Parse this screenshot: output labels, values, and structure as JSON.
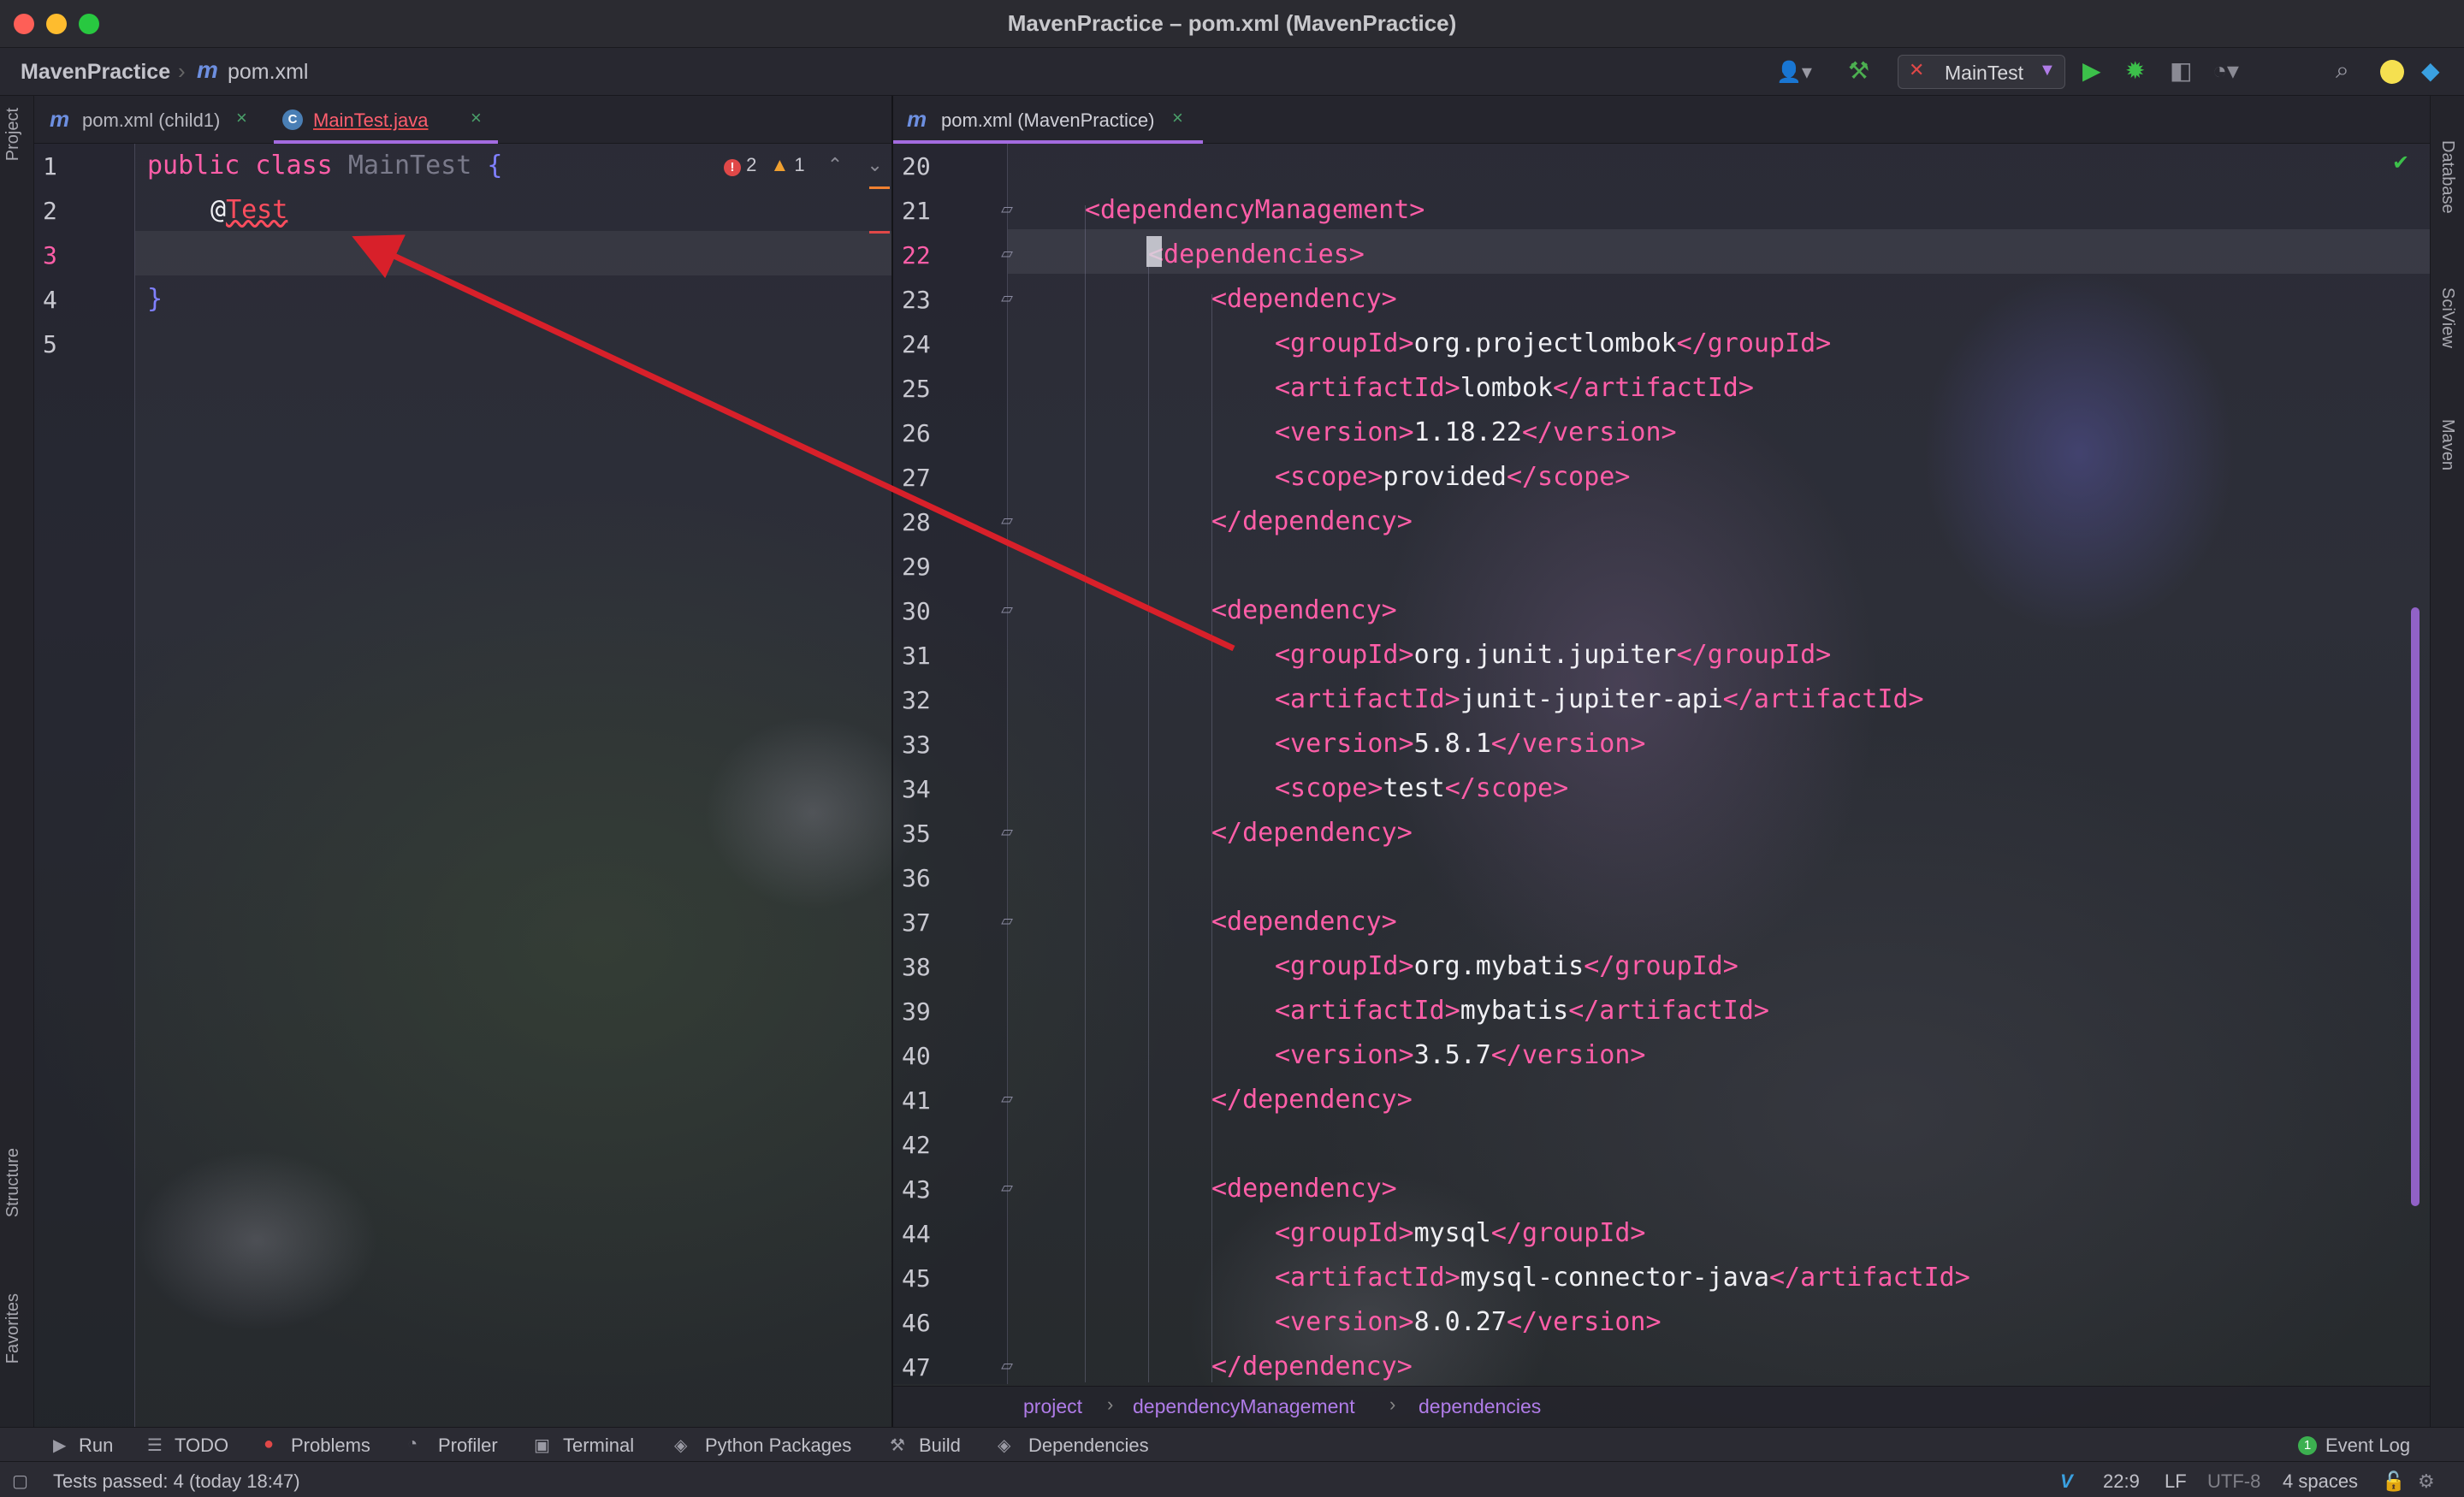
{
  "window": {
    "title": "MavenPractice – pom.xml (MavenPractice)"
  },
  "navbar": {
    "project": "MavenPractice",
    "file_icon": "m",
    "file": "pom.xml",
    "run_config": "MainTest"
  },
  "left_strip": {
    "project": "Project",
    "structure": "Structure",
    "favorites": "Favorites"
  },
  "right_strip": {
    "database": "Database",
    "sciview": "SciView",
    "maven": "Maven"
  },
  "left_tabs": [
    {
      "icon": "m",
      "label": "pom.xml (child1)",
      "close": "×"
    },
    {
      "icon": "C",
      "label": "MainTest.java",
      "close": "×"
    }
  ],
  "right_tabs": [
    {
      "icon": "m",
      "label": "pom.xml (MavenPractice)",
      "close": "×"
    }
  ],
  "left_editor": {
    "inspections": {
      "errors": "2",
      "warnings": "1"
    },
    "lines": [
      {
        "num": "1",
        "parts": [
          "public",
          " class ",
          "MainTest",
          " {"
        ]
      },
      {
        "num": "2",
        "parts": [
          "@",
          "Test"
        ]
      },
      {
        "num": "3",
        "parts": []
      },
      {
        "num": "4",
        "parts": [
          "}"
        ]
      },
      {
        "num": "5",
        "parts": []
      }
    ]
  },
  "right_editor": {
    "lines": [
      {
        "num": "20",
        "open": "",
        "text": "",
        "close": ""
      },
      {
        "num": "21",
        "open": "<dependencyManagement>",
        "text": "",
        "close": ""
      },
      {
        "num": "22",
        "open": "<dependencies>",
        "text": "",
        "close": ""
      },
      {
        "num": "23",
        "open": "<dependency>",
        "text": "",
        "close": ""
      },
      {
        "num": "24",
        "open": "<groupId>",
        "text": "org.projectlombok",
        "close": "</groupId>"
      },
      {
        "num": "25",
        "open": "<artifactId>",
        "text": "lombok",
        "close": "</artifactId>"
      },
      {
        "num": "26",
        "open": "<version>",
        "text": "1.18.22",
        "close": "</version>"
      },
      {
        "num": "27",
        "open": "<scope>",
        "text": "provided",
        "close": "</scope>"
      },
      {
        "num": "28",
        "open": "</dependency>",
        "text": "",
        "close": ""
      },
      {
        "num": "29",
        "open": "",
        "text": "",
        "close": ""
      },
      {
        "num": "30",
        "open": "<dependency>",
        "text": "",
        "close": ""
      },
      {
        "num": "31",
        "open": "<groupId>",
        "text": "org.junit.jupiter",
        "close": "</groupId>"
      },
      {
        "num": "32",
        "open": "<artifactId>",
        "text": "junit-jupiter-api",
        "close": "</artifactId>"
      },
      {
        "num": "33",
        "open": "<version>",
        "text": "5.8.1",
        "close": "</version>"
      },
      {
        "num": "34",
        "open": "<scope>",
        "text": "test",
        "close": "</scope>"
      },
      {
        "num": "35",
        "open": "</dependency>",
        "text": "",
        "close": ""
      },
      {
        "num": "36",
        "open": "",
        "text": "",
        "close": ""
      },
      {
        "num": "37",
        "open": "<dependency>",
        "text": "",
        "close": ""
      },
      {
        "num": "38",
        "open": "<groupId>",
        "text": "org.mybatis",
        "close": "</groupId>"
      },
      {
        "num": "39",
        "open": "<artifactId>",
        "text": "mybatis",
        "close": "</artifactId>"
      },
      {
        "num": "40",
        "open": "<version>",
        "text": "3.5.7",
        "close": "</version>"
      },
      {
        "num": "41",
        "open": "</dependency>",
        "text": "",
        "close": ""
      },
      {
        "num": "42",
        "open": "",
        "text": "",
        "close": ""
      },
      {
        "num": "43",
        "open": "<dependency>",
        "text": "",
        "close": ""
      },
      {
        "num": "44",
        "open": "<groupId>",
        "text": "mysql",
        "close": "</groupId>"
      },
      {
        "num": "45",
        "open": "<artifactId>",
        "text": "mysql-connector-java",
        "close": "</artifactId>"
      },
      {
        "num": "46",
        "open": "<version>",
        "text": "8.0.27",
        "close": "</version>"
      },
      {
        "num": "47",
        "open": "</dependency>",
        "text": "",
        "close": ""
      }
    ],
    "breadcrumb": [
      "project",
      "dependencyManagement",
      "dependencies"
    ]
  },
  "bottom_tabs": [
    "Run",
    "TODO",
    "Problems",
    "Profiler",
    "Terminal",
    "Python Packages",
    "Build",
    "Dependencies"
  ],
  "event_log": {
    "badge": "1",
    "label": "Event Log"
  },
  "status": {
    "message": "Tests passed: 4 (today 18:47)",
    "position": "22:9",
    "line_sep": "LF",
    "encoding": "UTF-8",
    "indent": "4 spaces"
  },
  "colors": {
    "accent": "#a36be0",
    "tag": "#ff5ea8",
    "error": "#e04848"
  }
}
